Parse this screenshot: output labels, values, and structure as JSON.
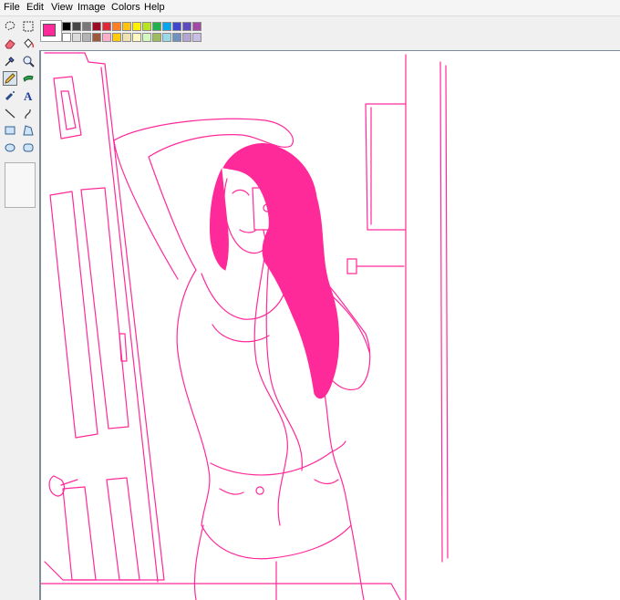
{
  "menubar": {
    "items": [
      "File",
      "Edit",
      "View",
      "Image",
      "Colors",
      "Help"
    ]
  },
  "toolbox": {
    "tools": [
      "free-select-icon",
      "rect-select-icon",
      "eraser-icon",
      "fill-bucket-icon",
      "color-picker-icon",
      "magnifier-icon",
      "pencil-icon",
      "brush-icon",
      "airbrush-icon",
      "text-icon",
      "line-icon",
      "curve-icon",
      "rectangle-icon",
      "polygon-icon",
      "ellipse-icon",
      "rounded-rectangle-icon"
    ],
    "active_tool": "pencil-icon"
  },
  "colors": {
    "foreground": "#ff2a9a",
    "background": "#ffffff",
    "palette_row1": [
      "#000000",
      "#464646",
      "#787878",
      "#9c0a23",
      "#e32636",
      "#ff7f27",
      "#ffc20e",
      "#fff200",
      "#b5e61d",
      "#22b14c",
      "#00a8f3",
      "#3f48cc",
      "#5e4bc4",
      "#a349a4"
    ],
    "palette_row2": [
      "#ffffff",
      "#dcdcdc",
      "#b4b4b4",
      "#9c5a3c",
      "#ffaec9",
      "#ffc90e",
      "#efe4b0",
      "#fffac2",
      "#d3f9bc",
      "#9dbb61",
      "#99d9ea",
      "#7092be",
      "#b5a5d5",
      "#c8bfe7"
    ]
  },
  "drawing": {
    "stroke_color": "#ff2a9a"
  }
}
